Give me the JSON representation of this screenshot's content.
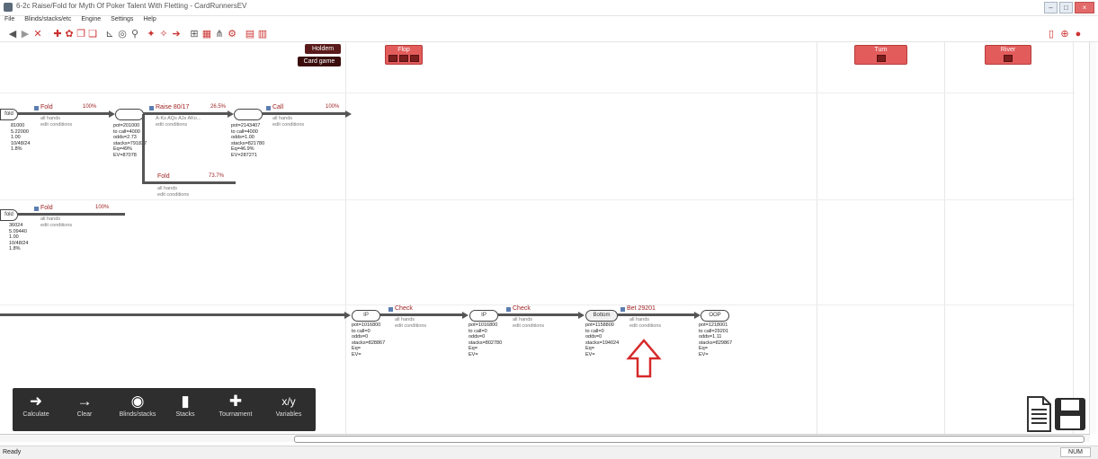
{
  "window": {
    "title": "6-2c Raise/Fold for Myth Of Poker Talent With Fletting - CardRunnersEV"
  },
  "menu": [
    "File",
    "Blinds/stacks/etc",
    "Engine",
    "Settings",
    "Help"
  ],
  "streets": {
    "preflop_top": "Holdem",
    "preflop_bottom": "Card game",
    "flop": "Flop",
    "turn": "Turn",
    "river": "River"
  },
  "tree": {
    "left_node_stub": "fold",
    "top_row": {
      "edge1": {
        "label": "Fold",
        "pct": "100%",
        "sub1": "all hands",
        "sub2": "edit conditions"
      },
      "edge2": {
        "label": "Raise 80/17",
        "pct": "26.5%",
        "sub1": "A-Ks AQs AJs AKo...",
        "sub2": "edit conditions"
      },
      "edge3": {
        "label": "Call",
        "pct": "100%",
        "sub1": "all hands",
        "sub2": "edit conditions"
      },
      "edge4": {
        "label": "Fold",
        "pct": "73.7%",
        "sub1": "all hands",
        "sub2": "edit conditions"
      },
      "left_stats": [
        "81000",
        "5.22000",
        "1.00",
        "10/48/24",
        "1.8%"
      ],
      "node1_stats": [
        "pot=201000",
        "to call=4000",
        "odds=2.73",
        "stacks=791837",
        "Eq=49%",
        "EV=87078"
      ],
      "node2_stats": [
        "pot=2143407",
        "to call=4000",
        "odds=1.00",
        "stacks=821780",
        "Eq=46.9%",
        "EV=287271"
      ]
    },
    "second_row": {
      "edge1": {
        "label": "Fold",
        "pct": "100%",
        "sub1": "all hands",
        "sub2": "edit conditions"
      },
      "left_stats": [
        "36024",
        "5.09440",
        "1.00",
        "10/48/24",
        "1.8%"
      ]
    },
    "bottom_row": {
      "edge1": {
        "label": "Check",
        "sub1": "all hands",
        "sub2": "edit conditions"
      },
      "edge2": {
        "label": "Check",
        "sub1": "all hands",
        "sub2": "edit conditions"
      },
      "edge3": {
        "label": "Bet 29201",
        "sub1": "all hands",
        "sub2": "edit conditions"
      },
      "node_flop": "IP",
      "node_turn": "IP",
      "node_river": "Bottom",
      "node_end": "OOP",
      "n1_stats": [
        "pot=1016800",
        "to call=0",
        "odds=0",
        "stacks=828867",
        "Eq=",
        "EV="
      ],
      "n2_stats": [
        "pot=1016800",
        "to call=0",
        "odds=0",
        "stacks=802780",
        "Eq=",
        "EV="
      ],
      "n3_stats": [
        "pot=1158800",
        "to call=0",
        "odds=0",
        "stacks=194024",
        "Eq=",
        "EV="
      ],
      "n4_stats": [
        "pot=1218001",
        "to call=29201",
        "odds=1.11",
        "stacks=829867",
        "Eq=",
        "EV="
      ]
    }
  },
  "dock": [
    {
      "label": "Calculate",
      "icon": "calculate-arrow-icon"
    },
    {
      "label": "Clear",
      "icon": "clear-arrow-icon"
    },
    {
      "label": "Blinds/stacks",
      "icon": "clock-icon"
    },
    {
      "label": "Stacks",
      "icon": "stacks-icon"
    },
    {
      "label": "Tournament",
      "icon": "tournament-icon"
    },
    {
      "label": "Variables",
      "icon": "variables-icon"
    }
  ],
  "status": {
    "left": "Ready",
    "right": "NUM"
  },
  "colors": {
    "street_red": "#e35c5c",
    "label_red": "#9c1c1c",
    "dark_badge": "#3a0c0c",
    "dock_bg": "#2e2e2e"
  }
}
